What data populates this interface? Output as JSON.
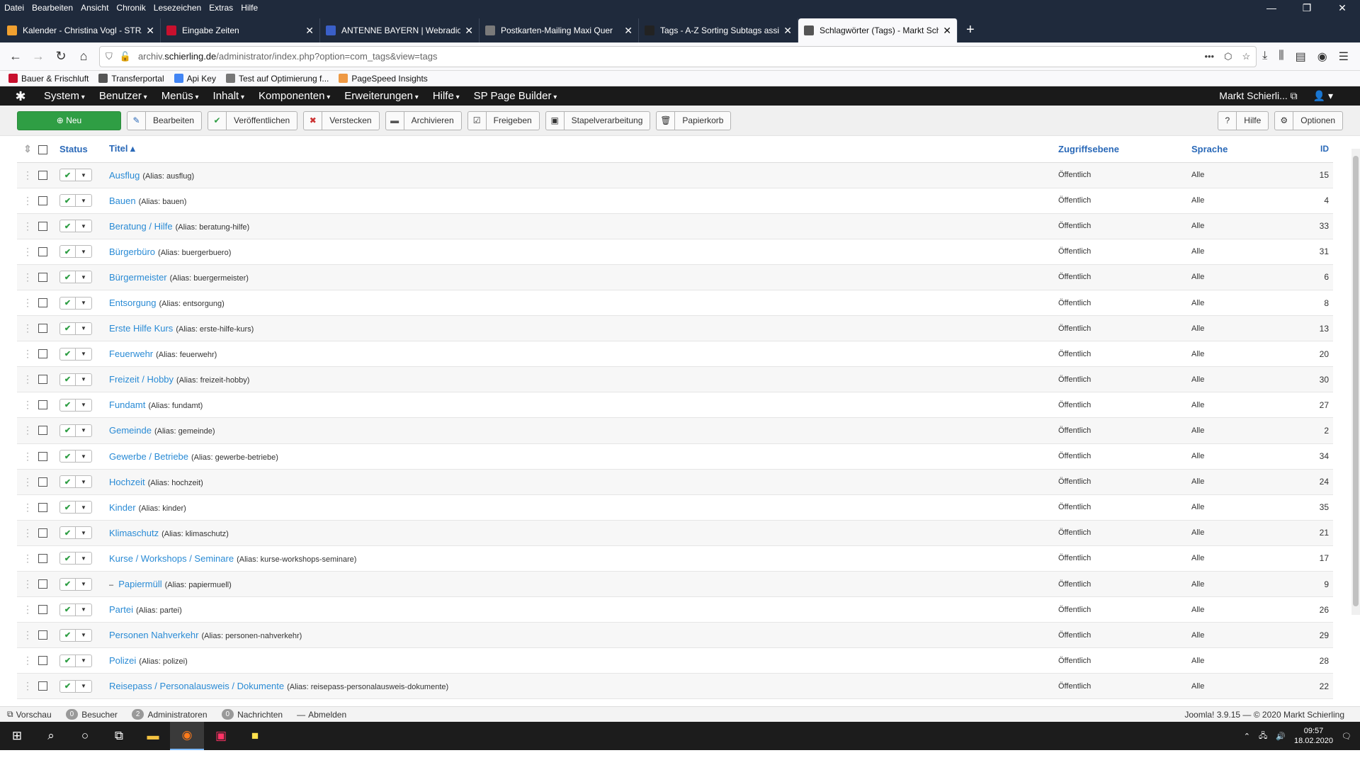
{
  "os_menu": [
    "Datei",
    "Bearbeiten",
    "Ansicht",
    "Chronik",
    "Lesezeichen",
    "Extras",
    "Hilfe"
  ],
  "tabs": [
    {
      "title": "Kalender - Christina Vogl - STRA",
      "color": "#f0a030"
    },
    {
      "title": "Eingabe Zeiten",
      "color": "#c8102e"
    },
    {
      "title": "ANTENNE BAYERN | Webradio",
      "color": "#3a5fc8"
    },
    {
      "title": "Postkarten-Mailing Maxi Quer",
      "color": "#7a7a7a"
    },
    {
      "title": "Tags - A-Z Sorting Subtags assi",
      "color": "#222"
    },
    {
      "title": "Schlagwörter (Tags) - Markt Schierling",
      "color": "#555"
    }
  ],
  "url": {
    "prefix": "archiv.",
    "domain": "schierling.de",
    "path": "/administrator/index.php?option=com_tags&view=tags"
  },
  "bookmarks": [
    "Bauer & Frischluft",
    "Transferportal",
    "Api Key",
    "Test auf Optimierung f...",
    "PageSpeed Insights"
  ],
  "joomla_menu": [
    "System",
    "Benutzer",
    "Menüs",
    "Inhalt",
    "Komponenten",
    "Erweiterungen",
    "Hilfe",
    "SP Page Builder"
  ],
  "user": "Markt Schierli...",
  "toolbar": {
    "new": "Neu",
    "buttons": [
      {
        "label": "Bearbeiten",
        "icon": "✎"
      },
      {
        "label": "Veröffentlichen",
        "icon": "✔"
      },
      {
        "label": "Verstecken",
        "icon": "✖"
      },
      {
        "label": "Archivieren",
        "icon": "▬"
      },
      {
        "label": "Freigeben",
        "icon": "☑"
      },
      {
        "label": "Stapelverarbeitung",
        "icon": "▣"
      },
      {
        "label": "Papierkorb",
        "icon": "🗑"
      }
    ],
    "help": "Hilfe",
    "options": "Optionen"
  },
  "columns": {
    "status": "Status",
    "title": "Titel ▴",
    "access": "Zugriffsebene",
    "language": "Sprache",
    "id": "ID"
  },
  "rows": [
    {
      "title": "Ausflug",
      "alias": "(Alias: ausflug)",
      "access": "Öffentlich",
      "lang": "Alle",
      "id": "15"
    },
    {
      "title": "Bauen",
      "alias": "(Alias: bauen)",
      "access": "Öffentlich",
      "lang": "Alle",
      "id": "4"
    },
    {
      "title": "Beratung / Hilfe",
      "alias": "(Alias: beratung-hilfe)",
      "access": "Öffentlich",
      "lang": "Alle",
      "id": "33"
    },
    {
      "title": "Bürgerbüro",
      "alias": "(Alias: buergerbuero)",
      "access": "Öffentlich",
      "lang": "Alle",
      "id": "31"
    },
    {
      "title": "Bürgermeister",
      "alias": "(Alias: buergermeister)",
      "access": "Öffentlich",
      "lang": "Alle",
      "id": "6"
    },
    {
      "title": "Entsorgung",
      "alias": "(Alias: entsorgung)",
      "access": "Öffentlich",
      "lang": "Alle",
      "id": "8"
    },
    {
      "title": "Erste Hilfe Kurs",
      "alias": "(Alias: erste-hilfe-kurs)",
      "access": "Öffentlich",
      "lang": "Alle",
      "id": "13"
    },
    {
      "title": "Feuerwehr",
      "alias": "(Alias: feuerwehr)",
      "access": "Öffentlich",
      "lang": "Alle",
      "id": "20"
    },
    {
      "title": "Freizeit / Hobby",
      "alias": "(Alias: freizeit-hobby)",
      "access": "Öffentlich",
      "lang": "Alle",
      "id": "30"
    },
    {
      "title": "Fundamt",
      "alias": "(Alias: fundamt)",
      "access": "Öffentlich",
      "lang": "Alle",
      "id": "27"
    },
    {
      "title": "Gemeinde",
      "alias": "(Alias: gemeinde)",
      "access": "Öffentlich",
      "lang": "Alle",
      "id": "2"
    },
    {
      "title": "Gewerbe / Betriebe",
      "alias": "(Alias: gewerbe-betriebe)",
      "access": "Öffentlich",
      "lang": "Alle",
      "id": "34"
    },
    {
      "title": "Hochzeit",
      "alias": "(Alias: hochzeit)",
      "access": "Öffentlich",
      "lang": "Alle",
      "id": "24"
    },
    {
      "title": "Kinder",
      "alias": "(Alias: kinder)",
      "access": "Öffentlich",
      "lang": "Alle",
      "id": "35"
    },
    {
      "title": "Klimaschutz",
      "alias": "(Alias: klimaschutz)",
      "access": "Öffentlich",
      "lang": "Alle",
      "id": "21"
    },
    {
      "title": "Kurse / Workshops / Seminare",
      "alias": "(Alias: kurse-workshops-seminare)",
      "access": "Öffentlich",
      "lang": "Alle",
      "id": "17"
    },
    {
      "title": "Papiermüll",
      "prefix": "– ",
      "alias": "(Alias: papiermuell)",
      "access": "Öffentlich",
      "lang": "Alle",
      "id": "9"
    },
    {
      "title": "Partei",
      "alias": "(Alias: partei)",
      "access": "Öffentlich",
      "lang": "Alle",
      "id": "26"
    },
    {
      "title": "Personen Nahverkehr",
      "alias": "(Alias: personen-nahverkehr)",
      "access": "Öffentlich",
      "lang": "Alle",
      "id": "29"
    },
    {
      "title": "Polizei",
      "alias": "(Alias: polizei)",
      "access": "Öffentlich",
      "lang": "Alle",
      "id": "28"
    },
    {
      "title": "Reisepass / Personalausweis / Dokumente",
      "alias": "(Alias: reisepass-personalausweis-dokumente)",
      "access": "Öffentlich",
      "lang": "Alle",
      "id": "22"
    }
  ],
  "statusbar": {
    "preview": "Vorschau",
    "visitors_count": "0",
    "visitors": "Besucher",
    "admins_count": "2",
    "admins": "Administratoren",
    "messages_count": "0",
    "messages": "Nachrichten",
    "logout": "Abmelden",
    "footer": "Joomla! 3.9.15 — © 2020 Markt Schierling"
  },
  "clock": {
    "time": "09:57",
    "date": "18.02.2020"
  }
}
